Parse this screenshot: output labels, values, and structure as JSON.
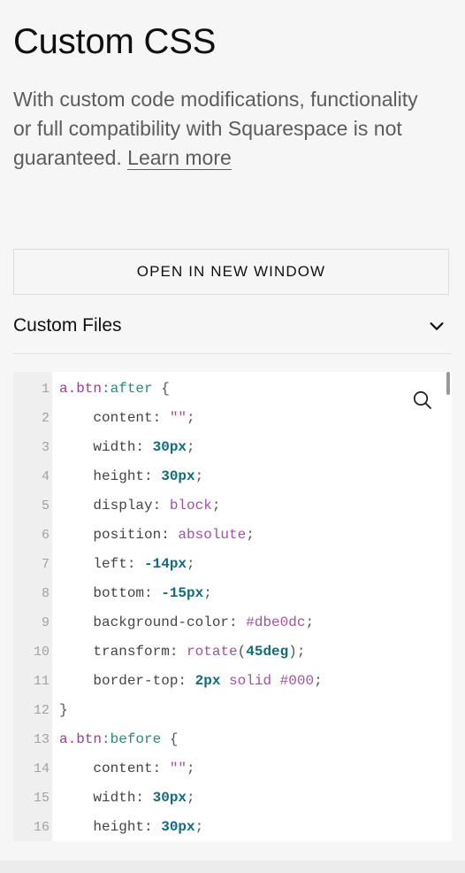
{
  "panel": {
    "title": "Custom CSS",
    "description": "With custom code modifications, functionality or full compatibility with Squarespace is not guaranteed.",
    "learn_more_label": "Learn more",
    "open_button_label": "OPEN IN NEW WINDOW",
    "custom_files_label": "Custom Files"
  },
  "editor": {
    "line_numbers": [
      "1",
      "2",
      "3",
      "4",
      "5",
      "6",
      "7",
      "8",
      "9",
      "10",
      "11",
      "12",
      "13",
      "14",
      "15",
      "16"
    ],
    "lines": [
      [
        {
          "t": "a.btn",
          "c": "sel"
        },
        {
          "t": ":after",
          "c": "pseudo"
        },
        {
          "t": " {",
          "c": "punc"
        }
      ],
      [
        {
          "t": "    content: ",
          "c": "prop"
        },
        {
          "t": "\"\"",
          "c": "str"
        },
        {
          "t": ";",
          "c": "punc"
        }
      ],
      [
        {
          "t": "    width: ",
          "c": "prop"
        },
        {
          "t": "30px",
          "c": "num"
        },
        {
          "t": ";",
          "c": "punc"
        }
      ],
      [
        {
          "t": "    height: ",
          "c": "prop"
        },
        {
          "t": "30px",
          "c": "num"
        },
        {
          "t": ";",
          "c": "punc"
        }
      ],
      [
        {
          "t": "    display: ",
          "c": "prop"
        },
        {
          "t": "block",
          "c": "kw"
        },
        {
          "t": ";",
          "c": "punc"
        }
      ],
      [
        {
          "t": "    position: ",
          "c": "prop"
        },
        {
          "t": "absolute",
          "c": "kw"
        },
        {
          "t": ";",
          "c": "punc"
        }
      ],
      [
        {
          "t": "    left: ",
          "c": "prop"
        },
        {
          "t": "-14px",
          "c": "num"
        },
        {
          "t": ";",
          "c": "punc"
        }
      ],
      [
        {
          "t": "    bottom: ",
          "c": "prop"
        },
        {
          "t": "-15px",
          "c": "num"
        },
        {
          "t": ";",
          "c": "punc"
        }
      ],
      [
        {
          "t": "    background-color: ",
          "c": "prop"
        },
        {
          "t": "#dbe0dc",
          "c": "kw"
        },
        {
          "t": ";",
          "c": "punc"
        }
      ],
      [
        {
          "t": "    transform: ",
          "c": "prop"
        },
        {
          "t": "rotate",
          "c": "kw"
        },
        {
          "t": "(",
          "c": "punc"
        },
        {
          "t": "45deg",
          "c": "num"
        },
        {
          "t": ");",
          "c": "punc"
        }
      ],
      [
        {
          "t": "    border-top: ",
          "c": "prop"
        },
        {
          "t": "2px",
          "c": "num"
        },
        {
          "t": " solid #000",
          "c": "kw"
        },
        {
          "t": ";",
          "c": "punc"
        }
      ],
      [
        {
          "t": "}",
          "c": "punc"
        }
      ],
      [
        {
          "t": "a.btn",
          "c": "sel"
        },
        {
          "t": ":before",
          "c": "pseudo"
        },
        {
          "t": " {",
          "c": "punc"
        }
      ],
      [
        {
          "t": "    content: ",
          "c": "prop"
        },
        {
          "t": "\"\"",
          "c": "str"
        },
        {
          "t": ";",
          "c": "punc"
        }
      ],
      [
        {
          "t": "    width: ",
          "c": "prop"
        },
        {
          "t": "30px",
          "c": "num"
        },
        {
          "t": ";",
          "c": "punc"
        }
      ],
      [
        {
          "t": "    height: ",
          "c": "prop"
        },
        {
          "t": "30px",
          "c": "num"
        },
        {
          "t": ";",
          "c": "punc"
        }
      ]
    ]
  },
  "icons": {
    "search": "search-icon",
    "chevron": "chevron-down-icon"
  }
}
